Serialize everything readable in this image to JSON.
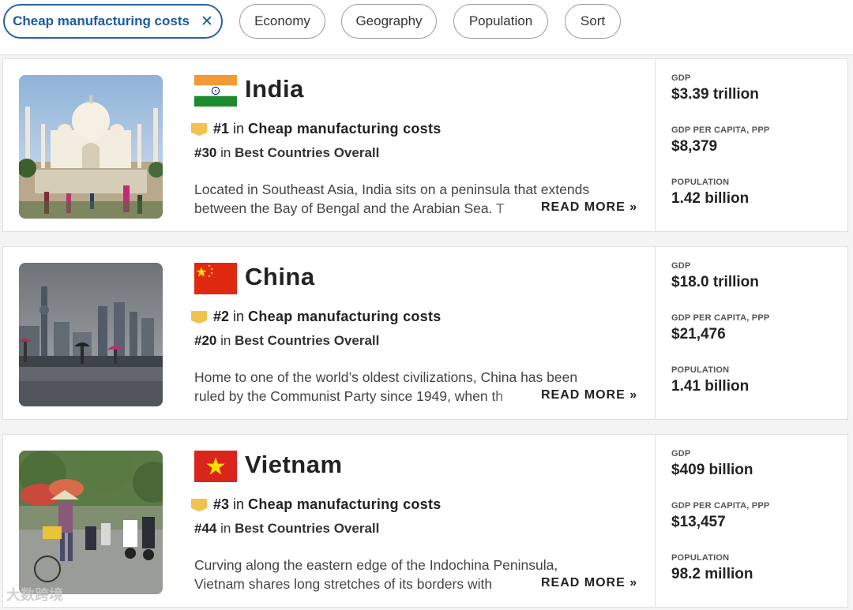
{
  "filters": {
    "active_label": "Cheap manufacturing costs",
    "close_symbol": "✕",
    "economy": "Economy",
    "geography": "Geography",
    "population": "Population",
    "sort": "Sort"
  },
  "stat_labels": {
    "gdp": "GDP",
    "gdp_per_capita": "GDP PER CAPITA, PPP",
    "population": "POPULATION"
  },
  "read_more": "READ MORE »",
  "countries": [
    {
      "name": "India",
      "rank_manufacturing": "#1",
      "rank_manufacturing_in": "in",
      "category": "Cheap manufacturing costs",
      "rank_overall": "#30",
      "rank_overall_in": "in",
      "overall_label": "Best Countries Overall",
      "desc_line1": "Located in Southeast Asia, India sits on a peninsula that extends",
      "desc_line2": "between the Bay of Bengal and the Arabian Sea. T",
      "gdp": "$3.39 trillion",
      "gdp_per_capita": "$8,379",
      "population": "1.42 billion"
    },
    {
      "name": "China",
      "rank_manufacturing": "#2",
      "rank_manufacturing_in": "in",
      "category": "Cheap manufacturing costs",
      "rank_overall": "#20",
      "rank_overall_in": "in",
      "overall_label": "Best Countries Overall",
      "desc_line1": "Home to one of the world’s oldest civilizations, China has been",
      "desc_line2": "ruled by the Communist Party since 1949, when th",
      "gdp": "$18.0 trillion",
      "gdp_per_capita": "$21,476",
      "population": "1.41 billion"
    },
    {
      "name": "Vietnam",
      "rank_manufacturing": "#3",
      "rank_manufacturing_in": "in",
      "category": "Cheap manufacturing costs",
      "rank_overall": "#44",
      "rank_overall_in": "in",
      "overall_label": "Best Countries Overall",
      "desc_line1": "Curving along the eastern edge of the Indochina Peninsula,",
      "desc_line2": "Vietnam shares long stretches of its borders with",
      "gdp": "$409 billion",
      "gdp_per_capita": "$13,457",
      "population": "98.2 million"
    }
  ],
  "watermark": "大数跨境",
  "colors": {
    "accent_blue": "#1c5aa0",
    "ribbon_gold": "#f2c14e",
    "india_saffron": "#f39a34",
    "india_green": "#1d8a2f",
    "china_red": "#de2910",
    "vietnam_red": "#da251d",
    "star_yellow": "#ffde00"
  }
}
